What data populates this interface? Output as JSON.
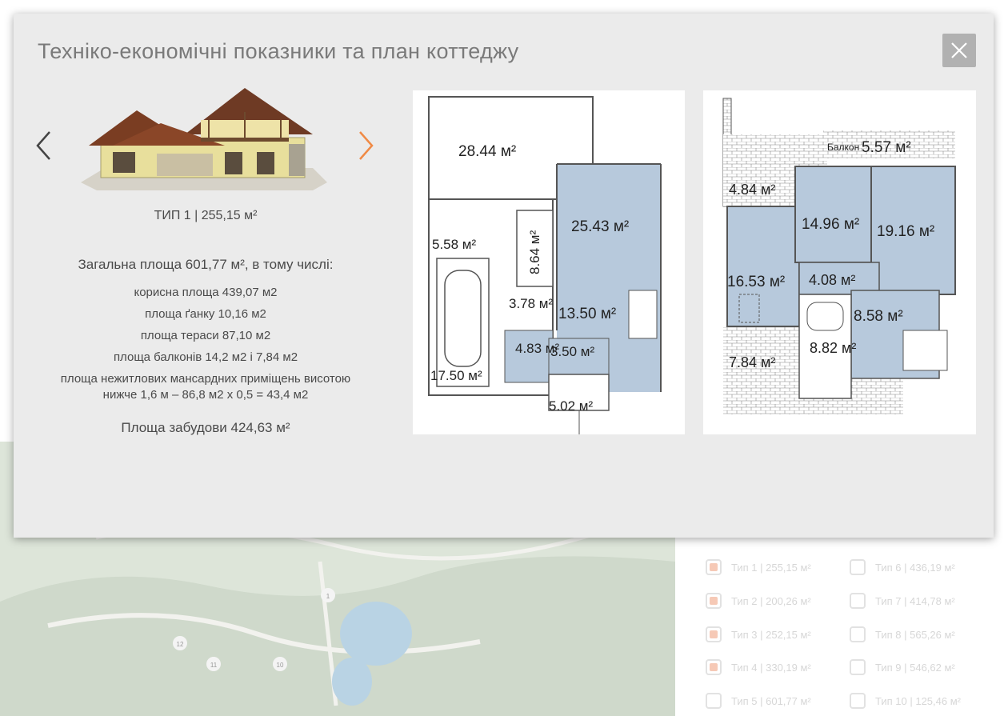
{
  "modal": {
    "title": "Техніко-економічні показники та план коттеджу",
    "type_caption": "ТИП 1  |  255,15 м²",
    "total_area": "Загальна площа 601,77 м², в тому числі:",
    "specs": [
      "корисна площа 439,07 м2",
      "площа ґанку 10,16 м2",
      "площа тераси 87,10 м2",
      "площа балконів 14,2 м2 і 7,84 м2",
      "площа нежитлових мансардних приміщень висотою нижче 1,6 м – 86,8 м2 х 0,5 = 43,4 м2"
    ],
    "build_area": "Площа забудови 424,63 м²",
    "arrow_color": "#f08a45"
  },
  "plan1": {
    "labels": [
      "28.44 м²",
      "25.43 м²",
      "5.58 м²",
      "8.64 м²",
      "3.78 м²",
      "13.50 м²",
      "4.83 м²",
      "3.50 м²",
      "17.50 м²",
      "5.02 м²"
    ]
  },
  "plan2": {
    "labels": [
      "Балкон",
      "5.57 м²",
      "4.84 м²",
      "14.96 м²",
      "19.16 м²",
      "16.53 м²",
      "4.08 м²",
      "8.58 м²",
      "8.82 м²",
      "7.84 м²"
    ]
  },
  "background": {
    "map_markers": [
      "12",
      "11",
      "10",
      "1"
    ],
    "types": [
      {
        "label": "Тип 1 | 255,15 м²",
        "checked": true
      },
      {
        "label": "Тип 2 | 200,26 м²",
        "checked": true
      },
      {
        "label": "Тип 3 | 252,15 м²",
        "checked": true
      },
      {
        "label": "Тип 4 | 330,19 м²",
        "checked": true
      },
      {
        "label": "Тип 5 | 601,77 м²",
        "checked": false
      },
      {
        "label": "Тип 6 | 436,19 м²",
        "checked": false
      },
      {
        "label": "Тип 7 | 414,78 м²",
        "checked": false
      },
      {
        "label": "Тип 8 | 565,26 м²",
        "checked": false
      },
      {
        "label": "Тип 9 | 546,62 м²",
        "checked": false
      },
      {
        "label": "Тип 10 | 125,46 м²",
        "checked": false
      }
    ]
  }
}
